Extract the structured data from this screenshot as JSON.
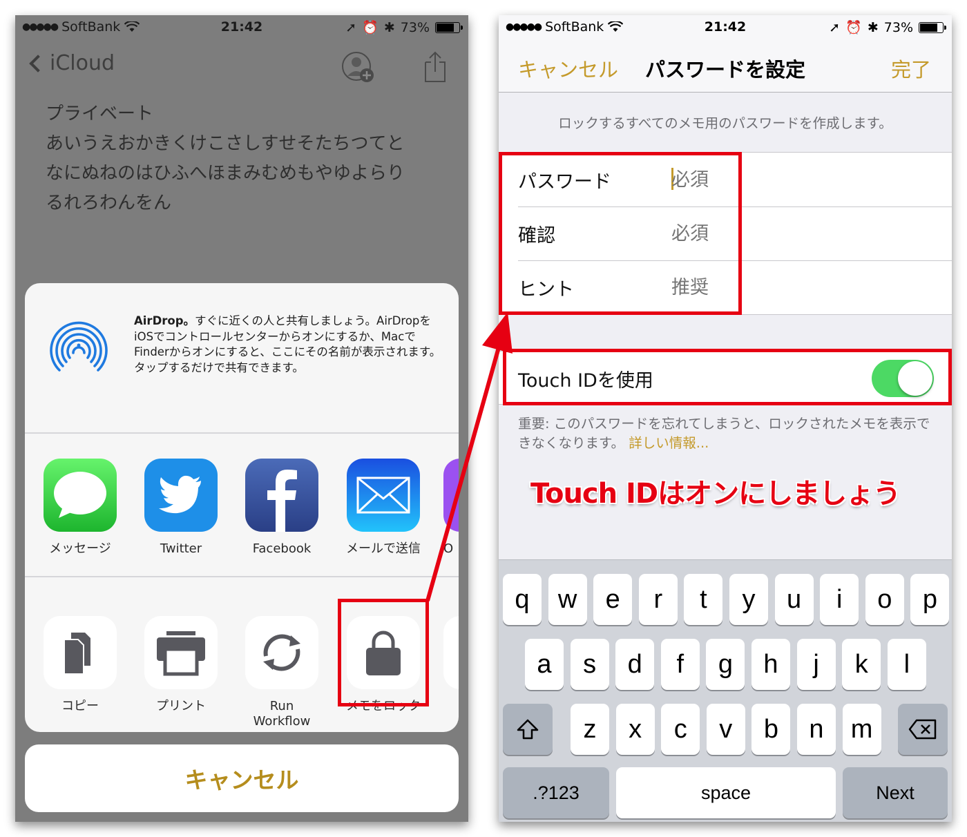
{
  "left": {
    "status": {
      "carrier": "SoftBank",
      "time": "21:42",
      "battery": "73%"
    },
    "nav": {
      "back_label": "iCloud"
    },
    "note_lines": [
      "プライベート",
      "あいうえおかきくけこさしすせそたちつてと",
      "なにぬねのはひふへほまみむめもやゆよらり",
      "るれろわんをん"
    ],
    "airdrop": {
      "title": "AirDrop。",
      "text": "すぐに近くの人と共有しましょう。AirDropをiOSでコントロールセンターからオンにするか、MacでFinderからオンにすると、ここにその名前が表示されます。タップするだけで共有できます。"
    },
    "apps": [
      {
        "label": "メッセージ",
        "icon": "messages-icon",
        "color": "#34c759"
      },
      {
        "label": "Twitter",
        "icon": "twitter-icon",
        "color": "#1d9bf0"
      },
      {
        "label": "Facebook",
        "icon": "facebook-icon",
        "color": "#3b5998"
      },
      {
        "label": "メールで送信",
        "icon": "mail-icon",
        "color": "#1f8ef1"
      },
      {
        "label": "O",
        "icon": "partial-app-icon",
        "color": "#9b51f0"
      }
    ],
    "actions": [
      {
        "label": "コピー",
        "icon": "copy-icon"
      },
      {
        "label": "プリント",
        "icon": "print-icon"
      },
      {
        "label": "Run\nWorkflow",
        "icon": "run-workflow-icon"
      },
      {
        "label": "メモをロック",
        "icon": "lock-icon"
      }
    ],
    "cancel_label": "キャンセル"
  },
  "right": {
    "status": {
      "carrier": "SoftBank",
      "time": "21:42",
      "battery": "73%"
    },
    "nav": {
      "cancel_label": "キャンセル",
      "title": "パスワードを設定",
      "done_label": "完了"
    },
    "description": "ロックするすべてのメモ用のパスワードを作成します。",
    "fields": [
      {
        "label": "パスワード",
        "placeholder": "必須"
      },
      {
        "label": "確認",
        "placeholder": "必須"
      },
      {
        "label": "ヒント",
        "placeholder": "推奨"
      }
    ],
    "touch_id": {
      "label": "Touch IDを使用",
      "enabled": true
    },
    "note": "重要: このパスワードを忘れてしまうと、ロックされたメモを表示できなくなります。",
    "note_link": "詳しい情報...",
    "keyboard": {
      "row1": [
        "q",
        "w",
        "e",
        "r",
        "t",
        "y",
        "u",
        "i",
        "o",
        "p"
      ],
      "row2": [
        "a",
        "s",
        "d",
        "f",
        "g",
        "h",
        "j",
        "k",
        "l"
      ],
      "row3": [
        "z",
        "x",
        "c",
        "v",
        "b",
        "n",
        "m"
      ],
      "numbers_label": ".?123",
      "space_label": "space",
      "next_label": "Next"
    }
  },
  "annotation": {
    "text": "Touch IDはオンにしましょう",
    "color": "#e60012"
  }
}
